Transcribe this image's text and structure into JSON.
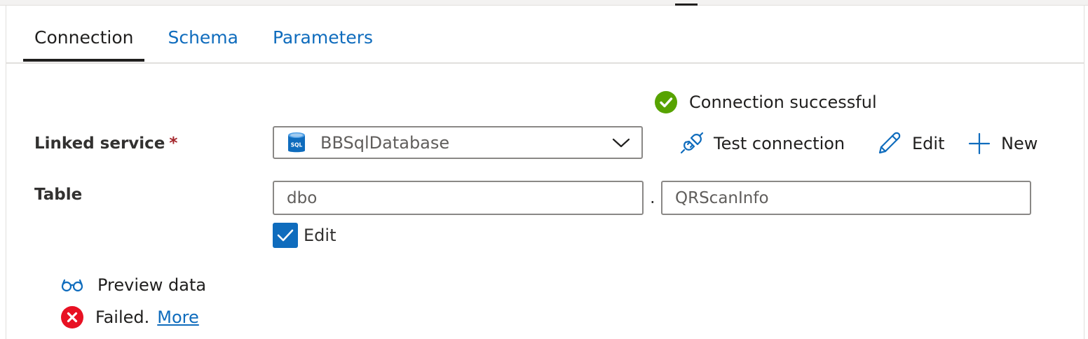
{
  "tabs": [
    {
      "label": "Connection",
      "active": true
    },
    {
      "label": "Schema",
      "active": false
    },
    {
      "label": "Parameters",
      "active": false
    }
  ],
  "status": {
    "connection_message": "Connection successful",
    "icon": "check-circle-icon",
    "color": "#57a300"
  },
  "linked_service": {
    "label": "Linked service",
    "required_marker": "*",
    "selected_value": "BBSqlDatabase",
    "icon": "sql-database-icon",
    "icon_text": "SQL"
  },
  "actions": {
    "test_connection": "Test connection",
    "edit": "Edit",
    "new": "New"
  },
  "table": {
    "label": "Table",
    "schema_value": "dbo",
    "separator": ".",
    "table_value": "QRScanInfo",
    "edit_checkbox_label": "Edit",
    "edit_checked": true
  },
  "preview": {
    "label": "Preview data",
    "icon": "glasses-icon"
  },
  "failure": {
    "message": "Failed.",
    "more_link": "More",
    "icon": "error-circle-icon",
    "color": "#e81123"
  },
  "colors": {
    "accent": "#0f6cbd",
    "text": "#323130",
    "border": "#8a8886"
  }
}
